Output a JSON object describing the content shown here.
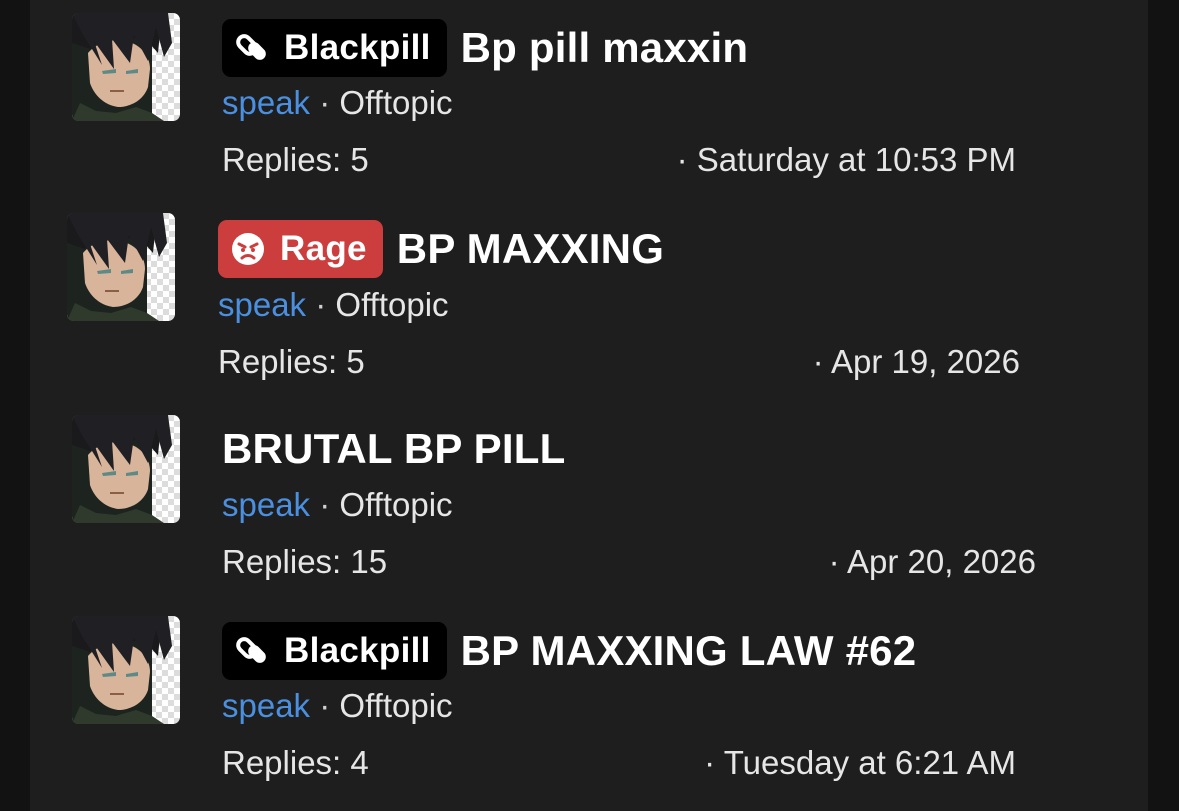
{
  "threads": [
    {
      "prefix": "Blackpill",
      "prefix_kind": "blackpill",
      "prefix_icon": "pill-icon",
      "title": "Bp pill maxxin",
      "author": "speak",
      "separator": "·",
      "forum": "Offtopic",
      "replies": "Replies: 5",
      "date": "· Saturday at 10:53 PM"
    },
    {
      "prefix": "Rage",
      "prefix_kind": "rage",
      "prefix_icon": "angry-face-icon",
      "title": "BP MAXXING",
      "author": "speak",
      "separator": "·",
      "forum": "Offtopic",
      "replies": "Replies: 5",
      "date": "· Apr 19, 2026"
    },
    {
      "prefix": "",
      "prefix_kind": "",
      "prefix_icon": "",
      "title": "BRUTAL BP PILL",
      "author": "speak",
      "separator": "·",
      "forum": "Offtopic",
      "replies": "Replies: 15",
      "date": "· Apr 20, 2026"
    },
    {
      "prefix": "Blackpill",
      "prefix_kind": "blackpill",
      "prefix_icon": "pill-icon",
      "title": "BP MAXXING LAW #62",
      "author": "speak",
      "separator": "·",
      "forum": "Offtopic",
      "replies": "Replies: 4",
      "date": "· Tuesday at 6:21 AM"
    }
  ],
  "colors": {
    "page_background": "#121212",
    "panel_background": "#1e1e1e",
    "author_link": "#4a8fe0",
    "rage_badge": "#cc3e3e",
    "blackpill_badge": "#000000"
  }
}
